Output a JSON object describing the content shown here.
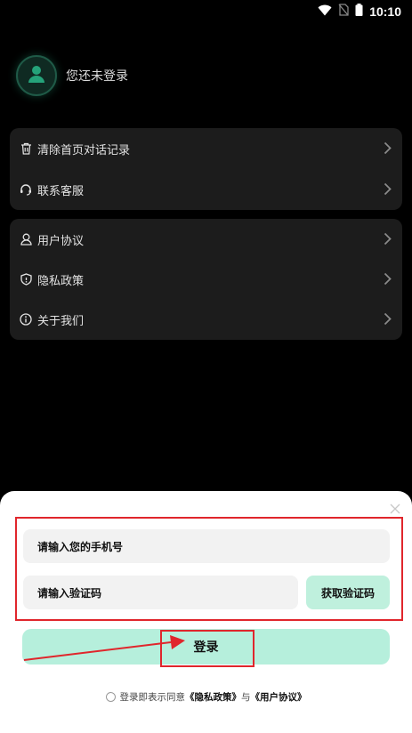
{
  "status_bar": {
    "time": "10:10",
    "icons": [
      "wifi-icon",
      "no-sim-icon",
      "battery-icon"
    ]
  },
  "profile": {
    "name": "您还未登录",
    "avatar_icon": "user-icon"
  },
  "menu_group_1": [
    {
      "label": "清除首页对话记录",
      "icon": "trash-icon"
    },
    {
      "label": "联系客服",
      "icon": "headset-icon"
    }
  ],
  "menu_group_2": [
    {
      "label": "用户协议",
      "icon": "user-outline-icon"
    },
    {
      "label": "隐私政策",
      "icon": "shield-icon"
    },
    {
      "label": "关于我们",
      "icon": "info-icon"
    }
  ],
  "login_sheet": {
    "phone_placeholder": "请输入您的手机号",
    "code_placeholder": "请输入验证码",
    "get_code_label": "获取验证码",
    "login_label": "登录",
    "agreement": {
      "prefix": "登录即表示同意",
      "privacy_link": "《隐私政策》",
      "conjunction": "与",
      "terms_link": "《用户协议》"
    }
  },
  "colors": {
    "background": "#000000",
    "card": "#1c1c1c",
    "accent": "#b6efdc",
    "annotation": "#e0262c"
  }
}
